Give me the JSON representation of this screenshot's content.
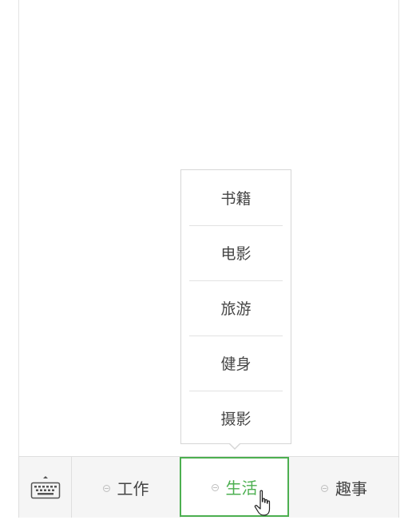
{
  "menu": {
    "items": [
      {
        "label": "工作"
      },
      {
        "label": "生活",
        "active": true
      },
      {
        "label": "趣事"
      }
    ],
    "submenu": [
      {
        "label": "书籍"
      },
      {
        "label": "电影"
      },
      {
        "label": "旅游"
      },
      {
        "label": "健身"
      },
      {
        "label": "摄影"
      }
    ],
    "keyboard_icon": "keyboard-icon"
  },
  "colors": {
    "active": "#4caf50",
    "text": "#444444",
    "border": "#dedede",
    "bar_bg": "#f5f5f5"
  }
}
